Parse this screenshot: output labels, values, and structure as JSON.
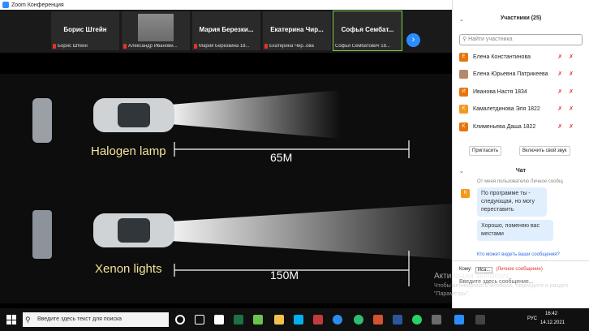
{
  "window": {
    "title": "Zoom Конференция",
    "controls": [
      "—",
      "☐",
      "✕"
    ]
  },
  "thumbs": [
    {
      "name": "Борис Штейн",
      "sub": "Борис Штейн"
    },
    {
      "name": "",
      "sub": "Александр Иванови..."
    },
    {
      "name": "Мария Березки...",
      "sub": "Мария Березкина 18..."
    },
    {
      "name": "Екатерина Чир...",
      "sub": "Екатерина Чир..ова"
    },
    {
      "name": "Софья Сембат...",
      "sub": "Софья Сембатович 18..."
    }
  ],
  "slide": {
    "label1": "Halogen lamp",
    "dist1": "65M",
    "label2": "Xenon lights",
    "dist2": "150M"
  },
  "participants": {
    "header": "Участники (25)",
    "search_placeholder": "Найти участника",
    "list": [
      {
        "initial": "Е",
        "name": "Елена Константинова"
      },
      {
        "initial": "",
        "name": "Елена Юрьевна Патрикеева"
      },
      {
        "initial": "И",
        "name": "Иванова Настя 1834"
      },
      {
        "initial": "К",
        "name": "Камалетдинова Эля 1822"
      },
      {
        "initial": "К",
        "name": "Клименьева Даша 1822"
      }
    ],
    "invite": "Пригласить",
    "unmute": "Включить свой звук"
  },
  "chat": {
    "header": "Чат",
    "from_line": "От меня пользователю  Личное сообщ",
    "messages": [
      "По программе ты - следующая, но могу переставить",
      "Хорошо, поменяю вас местами"
    ],
    "who_sees": "Кто может видеть ваши сообщения?",
    "to_label": "Кому:",
    "to_value": "Иса...",
    "private": "(Личное сообщение)",
    "input_placeholder": "Введите здесь сообщение..."
  },
  "activation": {
    "title": "Активация Windows",
    "text": "Чтобы активировать Windows, перейдите в раздел \"Параметры\"."
  },
  "taskbar": {
    "search": "Введите здесь текст для поиска",
    "lang": "РУС",
    "time": "16:42",
    "date": "14.12.2021"
  }
}
